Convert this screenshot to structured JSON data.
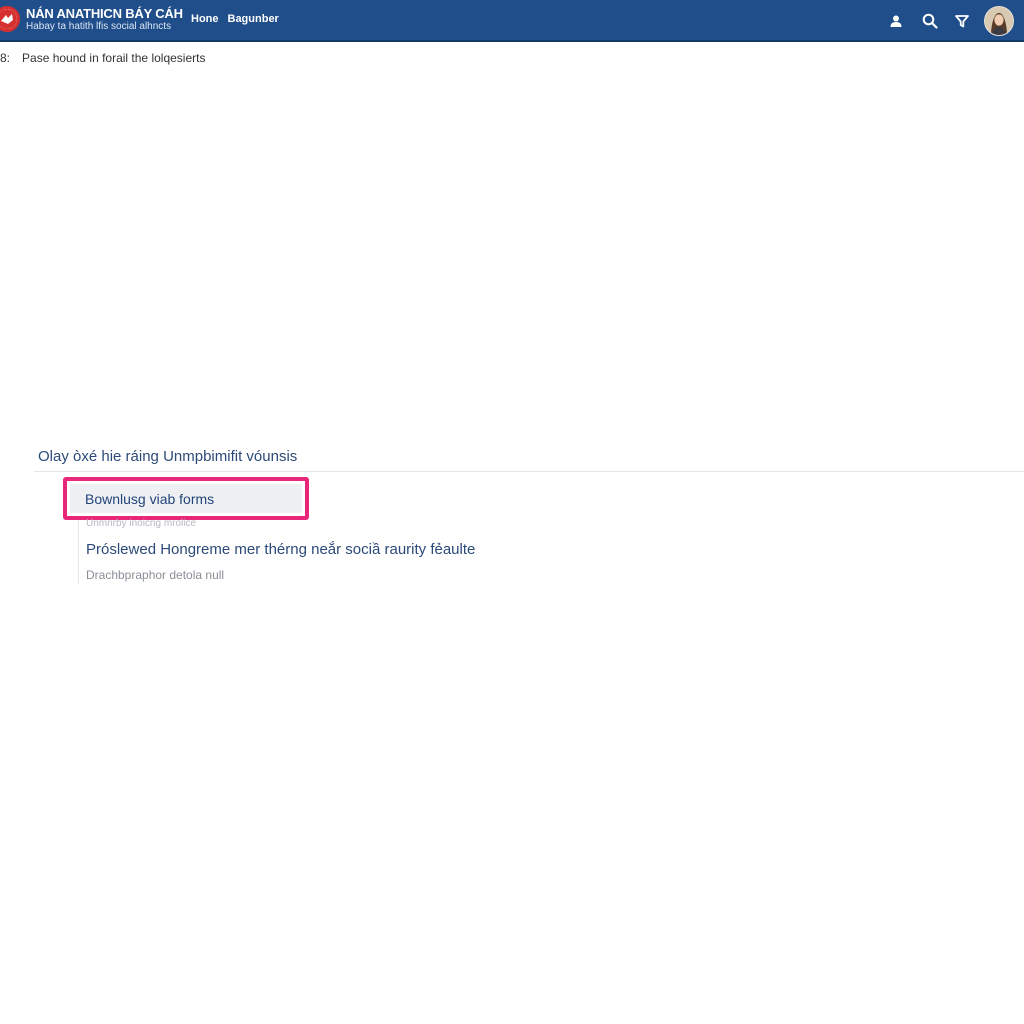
{
  "header": {
    "brand_title": "NÁN ANATHICN BÁY CÁH",
    "brand_tagline": "Habay ta hatith lfis social alhncts",
    "nav": [
      {
        "label": "Hone"
      },
      {
        "label": "Bagunber"
      }
    ],
    "icons": [
      "user-icon",
      "search-icon",
      "filter-icon"
    ],
    "colors": {
      "bar": "#1f4e8a",
      "logo_accent": "#d62f2f"
    }
  },
  "breadcrumb": {
    "number": "8:",
    "text": "Pase hound in forail the lolqesierts"
  },
  "results": {
    "heading": "Olay òxé hie ráing Unmpbimifit vóunsis",
    "highlighted_link": "Bownlusg viab forms",
    "highlighted_sub": "Unmnrby inoicng mrolice",
    "title": "Próslewed Hongreme mer thérng neắr sociầ raurity fẻaulte",
    "meta": "Drachbpraphor detola null",
    "highlight_color": "#e8267a"
  }
}
